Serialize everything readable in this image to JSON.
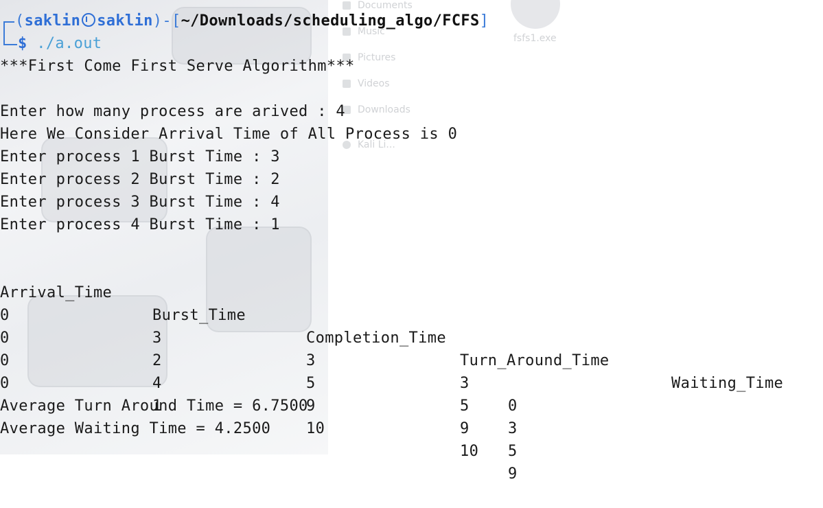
{
  "desktop_ghost": {
    "items": [
      "Documents",
      "Music",
      "Pictures",
      "Videos",
      "Downloads",
      "Kali Li...",
      "fsfs1.exe"
    ]
  },
  "prompt": {
    "open_paren": "(",
    "user": "saklin",
    "host": "saklin",
    "close_sep": ")-[",
    "path": "~/Downloads/scheduling_algo/FCFS",
    "close_bracket": "]",
    "dollar": "$",
    "command": "./a.out"
  },
  "output": {
    "title": "***First Come First Serve Algorithm***",
    "lines": [
      "Enter how many process are arived : 4",
      "Here We Consider Arrival Time of All Process is 0",
      "Enter process 1 Burst Time : 3",
      "Enter process 2 Burst Time : 2",
      "Enter process 3 Burst Time : 4",
      "Enter process 4 Burst Time : 1"
    ],
    "table": {
      "headers": [
        "Arrival_Time",
        "Burst_Time",
        "Completion_Time",
        "Turn_Around_Time",
        "Waiting_Time"
      ],
      "rows": [
        [
          "0",
          "3",
          "3",
          "3",
          "0"
        ],
        [
          "0",
          "2",
          "5",
          "5",
          "3"
        ],
        [
          "0",
          "4",
          "9",
          "9",
          "5"
        ],
        [
          "0",
          "1",
          "10",
          "10",
          "9"
        ]
      ]
    },
    "avg_tat": "Average Turn Around Time = 6.7500",
    "avg_wt": "Average Waiting Time = 4.2500"
  },
  "colors": {
    "prompt_blue": "#2f6fd6",
    "command_cyan": "#4aa0d6",
    "text": "#1a1a1a",
    "background": "#ffffff"
  }
}
